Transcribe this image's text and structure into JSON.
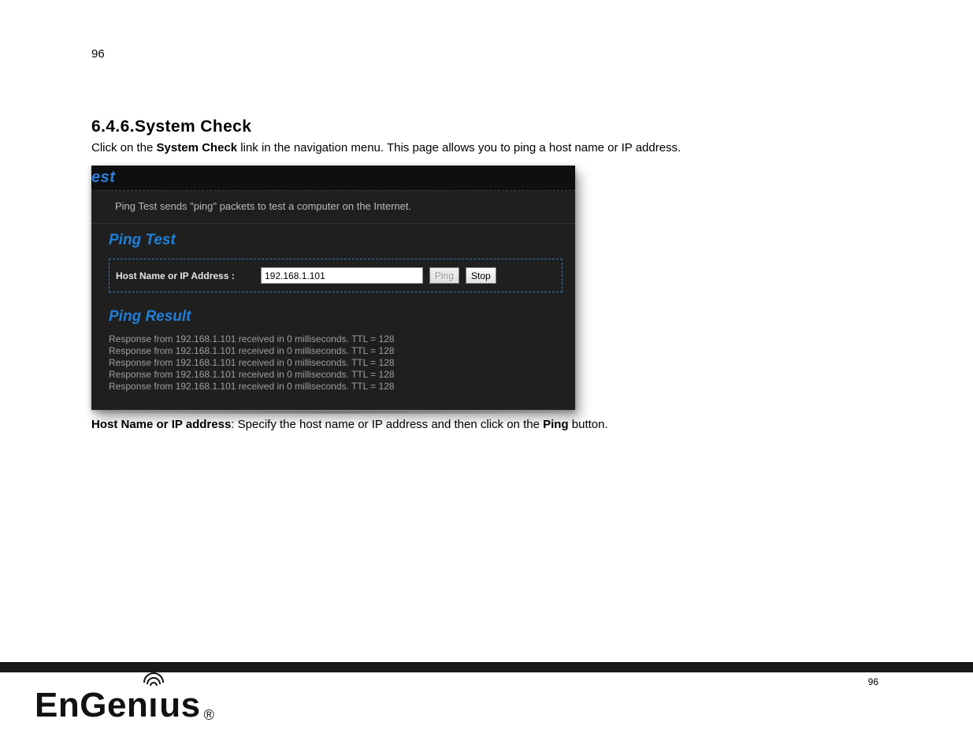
{
  "page": {
    "number_top": "96",
    "number_footer": "96"
  },
  "doc": {
    "heading": "6.4.6.System Check",
    "intro_pre": "Click on the ",
    "intro_bold": "System Check",
    "intro_post": " link in the navigation menu. This page allows you to ping a host name or IP address.",
    "caption_bold1": "Host Name or IP address",
    "caption_mid": ": Specify the host name or IP address and then click on the ",
    "caption_bold2": "Ping",
    "caption_end": " button."
  },
  "panel": {
    "title": "est",
    "desc": "Ping Test sends \"ping\" packets to test a computer on the Internet.",
    "ping_test_heading": "Ping Test",
    "form": {
      "label": "Host Name or IP Address :",
      "value": "192.168.1.101",
      "ping_btn": "Ping",
      "stop_btn": "Stop"
    },
    "result_heading": "Ping Result",
    "results": [
      "Response from 192.168.1.101 received in 0 milliseconds. TTL = 128",
      "Response from 192.168.1.101 received in 0 milliseconds. TTL = 128",
      "Response from 192.168.1.101 received in 0 milliseconds. TTL = 128",
      "Response from 192.168.1.101 received in 0 milliseconds. TTL = 128",
      "Response from 192.168.1.101 received in 0 milliseconds. TTL = 128"
    ]
  },
  "brand": {
    "name_part1": "EnGen",
    "name_part2": "us",
    "registered": "®"
  }
}
